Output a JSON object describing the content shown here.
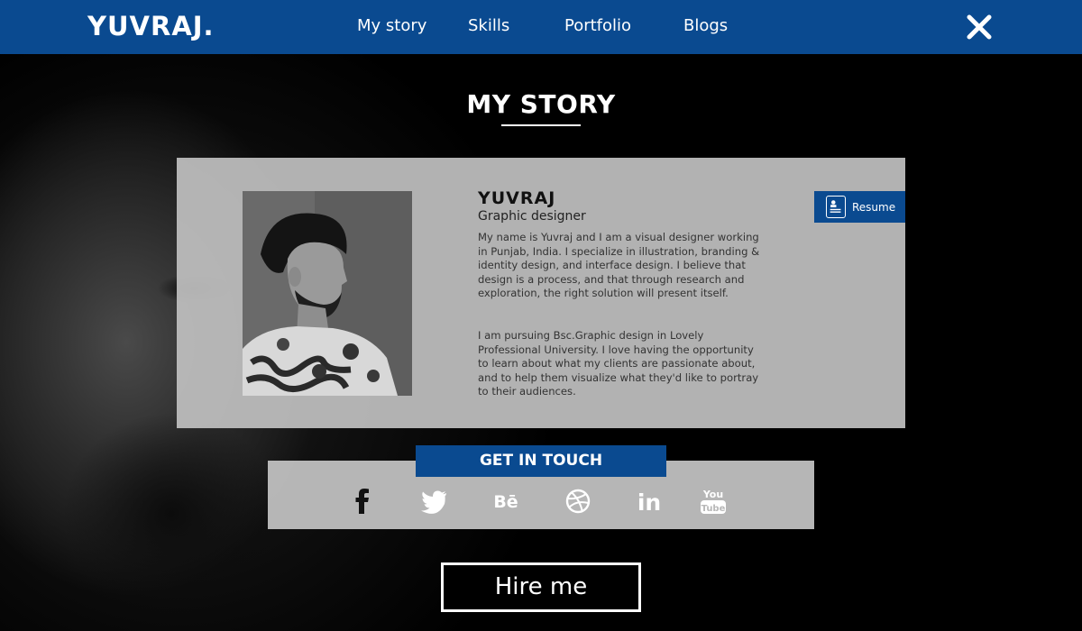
{
  "brand": {
    "logo_text": "YUVRAJ."
  },
  "nav": {
    "items": [
      {
        "label": "My story"
      },
      {
        "label": "Skills"
      },
      {
        "label": "Portfolio"
      },
      {
        "label": "Blogs"
      }
    ]
  },
  "page": {
    "title": "MY STORY"
  },
  "profile": {
    "name": "YUVRAJ",
    "role": "Graphic designer",
    "bio_paragraph_1": "My name is Yuvraj and I am a visual designer working in Punjab, India. I specialize in illustration, branding & identity design, and interface design. I believe that design is a process, and that through research and exploration, the right solution will present itself.",
    "bio_paragraph_2": "I am pursuing Bsc.Graphic design in Lovely Professional University. I love having the opportunity to learn about what my clients are passionate about, and to help them visualize what they'd like to portray to their audiences.",
    "resume_label": "Resume"
  },
  "contact": {
    "heading": "GET IN TOUCH",
    "socials": [
      {
        "icon": "facebook-icon"
      },
      {
        "icon": "twitter-icon"
      },
      {
        "icon": "behance-icon",
        "text": "Bē"
      },
      {
        "icon": "dribbble-icon"
      },
      {
        "icon": "linkedin-icon",
        "text": "in"
      },
      {
        "icon": "youtube-icon",
        "text_top": "You",
        "text_bottom": "Tube"
      }
    ]
  },
  "cta": {
    "hire_label": "Hire me"
  },
  "colors": {
    "accent": "#0a4a90",
    "card": "#c0c0c0",
    "background": "#000000"
  }
}
